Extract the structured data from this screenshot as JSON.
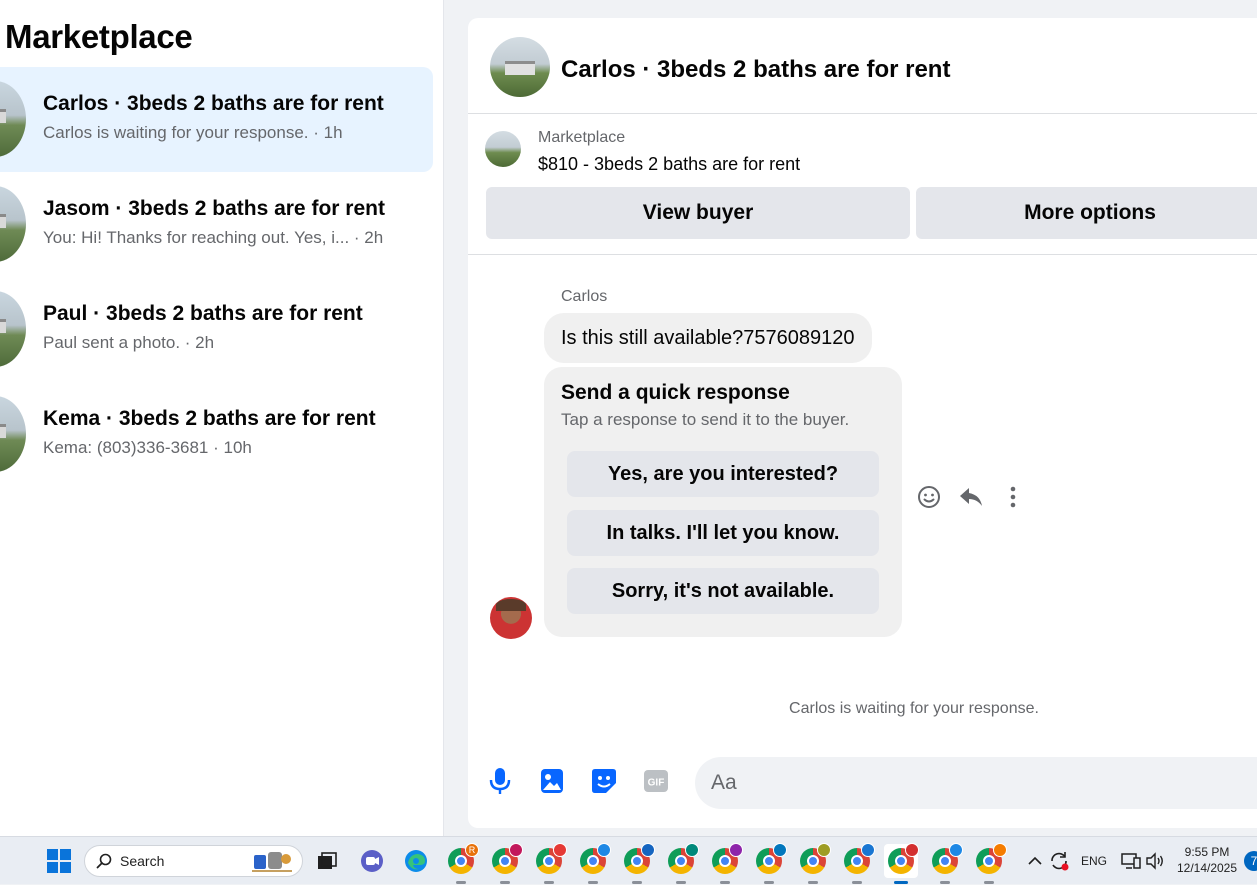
{
  "marketplace": {
    "title": "Marketplace",
    "conversations": [
      {
        "name": "Carlos · 3beds 2 baths are for rent",
        "subtitle": "Carlos is waiting for your response. · 1h",
        "active": true
      },
      {
        "name": "Jasom · 3beds 2 baths are for rent",
        "subtitle": "You: Hi! Thanks for reaching out. Yes, i... · 2h",
        "active": false
      },
      {
        "name": "Paul · 3beds 2 baths are for rent",
        "subtitle": "Paul sent a photo. · 2h",
        "active": false
      },
      {
        "name": "Kema · 3beds 2 baths are for rent",
        "subtitle": "Kema: (803)336-3681 · 10h",
        "active": false
      }
    ]
  },
  "chat": {
    "header_title": "Carlos · 3beds 2 baths are for rent",
    "listing": {
      "label": "Marketplace",
      "price_title": "$810 - 3beds 2 baths are for rent",
      "view_buyer": "View buyer",
      "more_options": "More options"
    },
    "sender_name": "Carlos",
    "message": "Is this still available?7576089120",
    "quick_response": {
      "title": "Send a quick response",
      "subtitle": "Tap a response to send it to the buyer.",
      "options": [
        "Yes, are you interested?",
        "In talks. I'll let you know.",
        "Sorry, it's not available."
      ]
    },
    "waiting_text": "Carlos is waiting for your response.",
    "composer_placeholder": "Aa",
    "composer_icons": [
      "microphone-icon",
      "photo-icon",
      "sticker-icon",
      "gif-icon"
    ],
    "accent_color": "#0866ff"
  },
  "taskbar": {
    "search_label": "Search",
    "language": "ENG",
    "time": "9:55 PM",
    "date": "12/14/2025",
    "notification_count": "7",
    "chrome_profile_badge": "R"
  }
}
